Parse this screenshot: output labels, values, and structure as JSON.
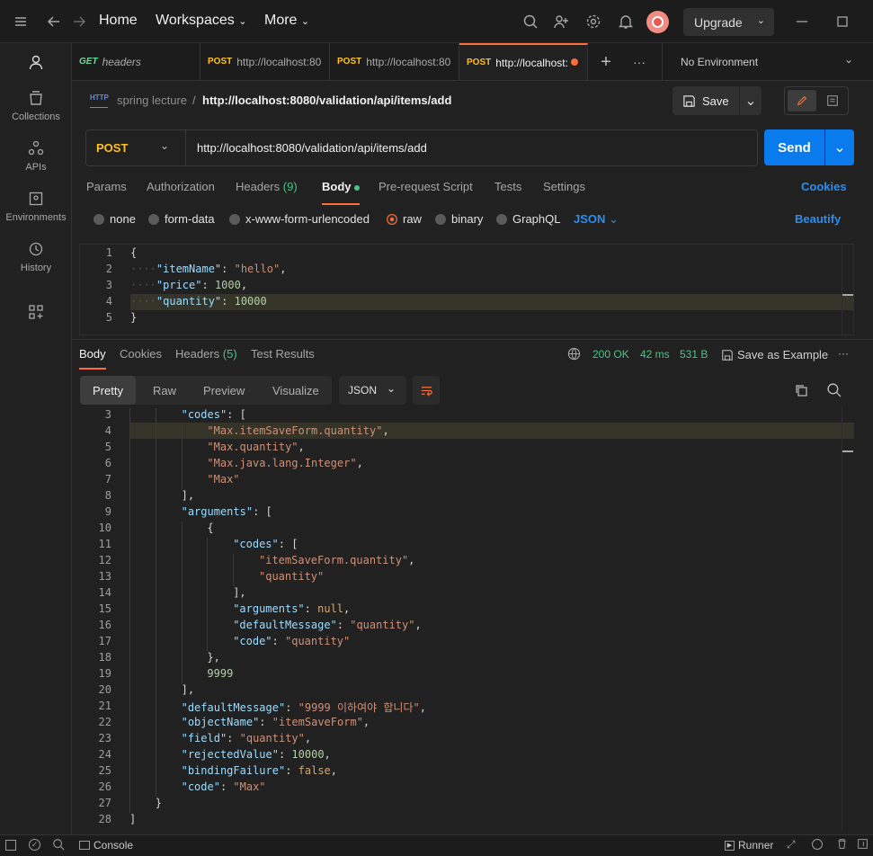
{
  "titlebar": {
    "home": "Home",
    "workspaces": "Workspaces",
    "more": "More",
    "upgrade": "Upgrade"
  },
  "sidebar": {
    "items": [
      {
        "label": "Collections",
        "icon": "collections-icon"
      },
      {
        "label": "APIs",
        "icon": "apis-icon"
      },
      {
        "label": "Environments",
        "icon": "environments-icon"
      },
      {
        "label": "History",
        "icon": "history-icon"
      }
    ]
  },
  "tabs": [
    {
      "method": "GET",
      "label": "headers"
    },
    {
      "method": "POST",
      "label": "http://localhost:80"
    },
    {
      "method": "POST",
      "label": "http://localhost:80"
    },
    {
      "method": "POST",
      "label": "http://localhost:"
    }
  ],
  "environment": "No Environment",
  "breadcrumb": {
    "collection": "spring lecture",
    "separator": "/",
    "request": "http://localhost:8080/validation/api/items/add"
  },
  "save_label": "Save",
  "request": {
    "method": "POST",
    "url": "http://localhost:8080/validation/api/items/add",
    "send": "Send"
  },
  "request_tabs": {
    "params": "Params",
    "authorization": "Authorization",
    "headers": "Headers",
    "headers_count": "(9)",
    "body": "Body",
    "pre_request": "Pre-request Script",
    "tests": "Tests",
    "settings": "Settings",
    "cookies": "Cookies"
  },
  "body_types": {
    "none": "none",
    "form_data": "form-data",
    "urlencoded": "x-www-form-urlencoded",
    "raw": "raw",
    "binary": "binary",
    "graphql": "GraphQL",
    "format": "JSON",
    "beautify": "Beautify"
  },
  "request_body": [
    {
      "n": "1",
      "text": "{"
    },
    {
      "n": "2",
      "key": "\"itemName\"",
      "val": "\"hello\"",
      "tail": ","
    },
    {
      "n": "3",
      "key": "\"price\"",
      "val": "1000",
      "tail": ","
    },
    {
      "n": "4",
      "key": "\"quantity\"",
      "val": "10000",
      "tail": ""
    },
    {
      "n": "5",
      "text": "}"
    }
  ],
  "response_tabs": {
    "body": "Body",
    "cookies": "Cookies",
    "headers": "Headers",
    "headers_count": "(5)",
    "test_results": "Test Results"
  },
  "response_status": {
    "code": "200 OK",
    "time": "42 ms",
    "size": "531 B",
    "save_example": "Save as Example"
  },
  "view_modes": {
    "pretty": "Pretty",
    "raw": "Raw",
    "preview": "Preview",
    "visualize": "Visualize",
    "format": "JSON"
  },
  "response_lines": [
    {
      "n": "3",
      "indent": 2,
      "parts": [
        [
          "k",
          "\"codes\""
        ],
        [
          "p",
          ": ["
        ]
      ]
    },
    {
      "n": "4",
      "indent": 3,
      "parts": [
        [
          "s",
          "\"Max.itemSaveForm.quantity\""
        ],
        [
          "p",
          ","
        ]
      ]
    },
    {
      "n": "5",
      "indent": 3,
      "parts": [
        [
          "s",
          "\"Max.quantity\""
        ],
        [
          "p",
          ","
        ]
      ]
    },
    {
      "n": "6",
      "indent": 3,
      "parts": [
        [
          "s",
          "\"Max.java.lang.Integer\""
        ],
        [
          "p",
          ","
        ]
      ]
    },
    {
      "n": "7",
      "indent": 3,
      "parts": [
        [
          "s",
          "\"Max\""
        ]
      ]
    },
    {
      "n": "8",
      "indent": 2,
      "parts": [
        [
          "p",
          "],"
        ]
      ]
    },
    {
      "n": "9",
      "indent": 2,
      "parts": [
        [
          "k",
          "\"arguments\""
        ],
        [
          "p",
          ": ["
        ]
      ]
    },
    {
      "n": "10",
      "indent": 3,
      "parts": [
        [
          "p",
          "{"
        ]
      ]
    },
    {
      "n": "11",
      "indent": 4,
      "parts": [
        [
          "k",
          "\"codes\""
        ],
        [
          "p",
          ": ["
        ]
      ]
    },
    {
      "n": "12",
      "indent": 5,
      "parts": [
        [
          "s",
          "\"itemSaveForm.quantity\""
        ],
        [
          "p",
          ","
        ]
      ]
    },
    {
      "n": "13",
      "indent": 5,
      "parts": [
        [
          "s",
          "\"quantity\""
        ]
      ]
    },
    {
      "n": "14",
      "indent": 4,
      "parts": [
        [
          "p",
          "],"
        ]
      ]
    },
    {
      "n": "15",
      "indent": 4,
      "parts": [
        [
          "k",
          "\"arguments\""
        ],
        [
          "p",
          ": "
        ],
        [
          "kw",
          "null"
        ],
        [
          "p",
          ","
        ]
      ]
    },
    {
      "n": "16",
      "indent": 4,
      "parts": [
        [
          "k",
          "\"defaultMessage\""
        ],
        [
          "p",
          ": "
        ],
        [
          "s",
          "\"quantity\""
        ],
        [
          "p",
          ","
        ]
      ]
    },
    {
      "n": "17",
      "indent": 4,
      "parts": [
        [
          "k",
          "\"code\""
        ],
        [
          "p",
          ": "
        ],
        [
          "s",
          "\"quantity\""
        ]
      ]
    },
    {
      "n": "18",
      "indent": 3,
      "parts": [
        [
          "p",
          "},"
        ]
      ]
    },
    {
      "n": "19",
      "indent": 3,
      "parts": [
        [
          "n",
          "9999"
        ]
      ]
    },
    {
      "n": "20",
      "indent": 2,
      "parts": [
        [
          "p",
          "],"
        ]
      ]
    },
    {
      "n": "21",
      "indent": 2,
      "parts": [
        [
          "k",
          "\"defaultMessage\""
        ],
        [
          "p",
          ": "
        ],
        [
          "s",
          "\"9999 이하여야 합니다\""
        ],
        [
          "p",
          ","
        ]
      ]
    },
    {
      "n": "22",
      "indent": 2,
      "parts": [
        [
          "k",
          "\"objectName\""
        ],
        [
          "p",
          ": "
        ],
        [
          "s",
          "\"itemSaveForm\""
        ],
        [
          "p",
          ","
        ]
      ]
    },
    {
      "n": "23",
      "indent": 2,
      "parts": [
        [
          "k",
          "\"field\""
        ],
        [
          "p",
          ": "
        ],
        [
          "s",
          "\"quantity\""
        ],
        [
          "p",
          ","
        ]
      ]
    },
    {
      "n": "24",
      "indent": 2,
      "parts": [
        [
          "k",
          "\"rejectedValue\""
        ],
        [
          "p",
          ": "
        ],
        [
          "n",
          "10000"
        ],
        [
          "p",
          ","
        ]
      ]
    },
    {
      "n": "25",
      "indent": 2,
      "parts": [
        [
          "k",
          "\"bindingFailure\""
        ],
        [
          "p",
          ": "
        ],
        [
          "kw",
          "false"
        ],
        [
          "p",
          ","
        ]
      ]
    },
    {
      "n": "26",
      "indent": 2,
      "parts": [
        [
          "k",
          "\"code\""
        ],
        [
          "p",
          ": "
        ],
        [
          "s",
          "\"Max\""
        ]
      ]
    },
    {
      "n": "27",
      "indent": 1,
      "parts": [
        [
          "p",
          "}"
        ]
      ]
    },
    {
      "n": "28",
      "indent": 0,
      "parts": [
        [
          "p",
          "]"
        ]
      ]
    }
  ],
  "statusbar": {
    "console": "Console",
    "runner": "Runner"
  },
  "colors": {
    "accent": "#ff6c37",
    "send": "#097bed",
    "status_ok": "#49c586"
  }
}
